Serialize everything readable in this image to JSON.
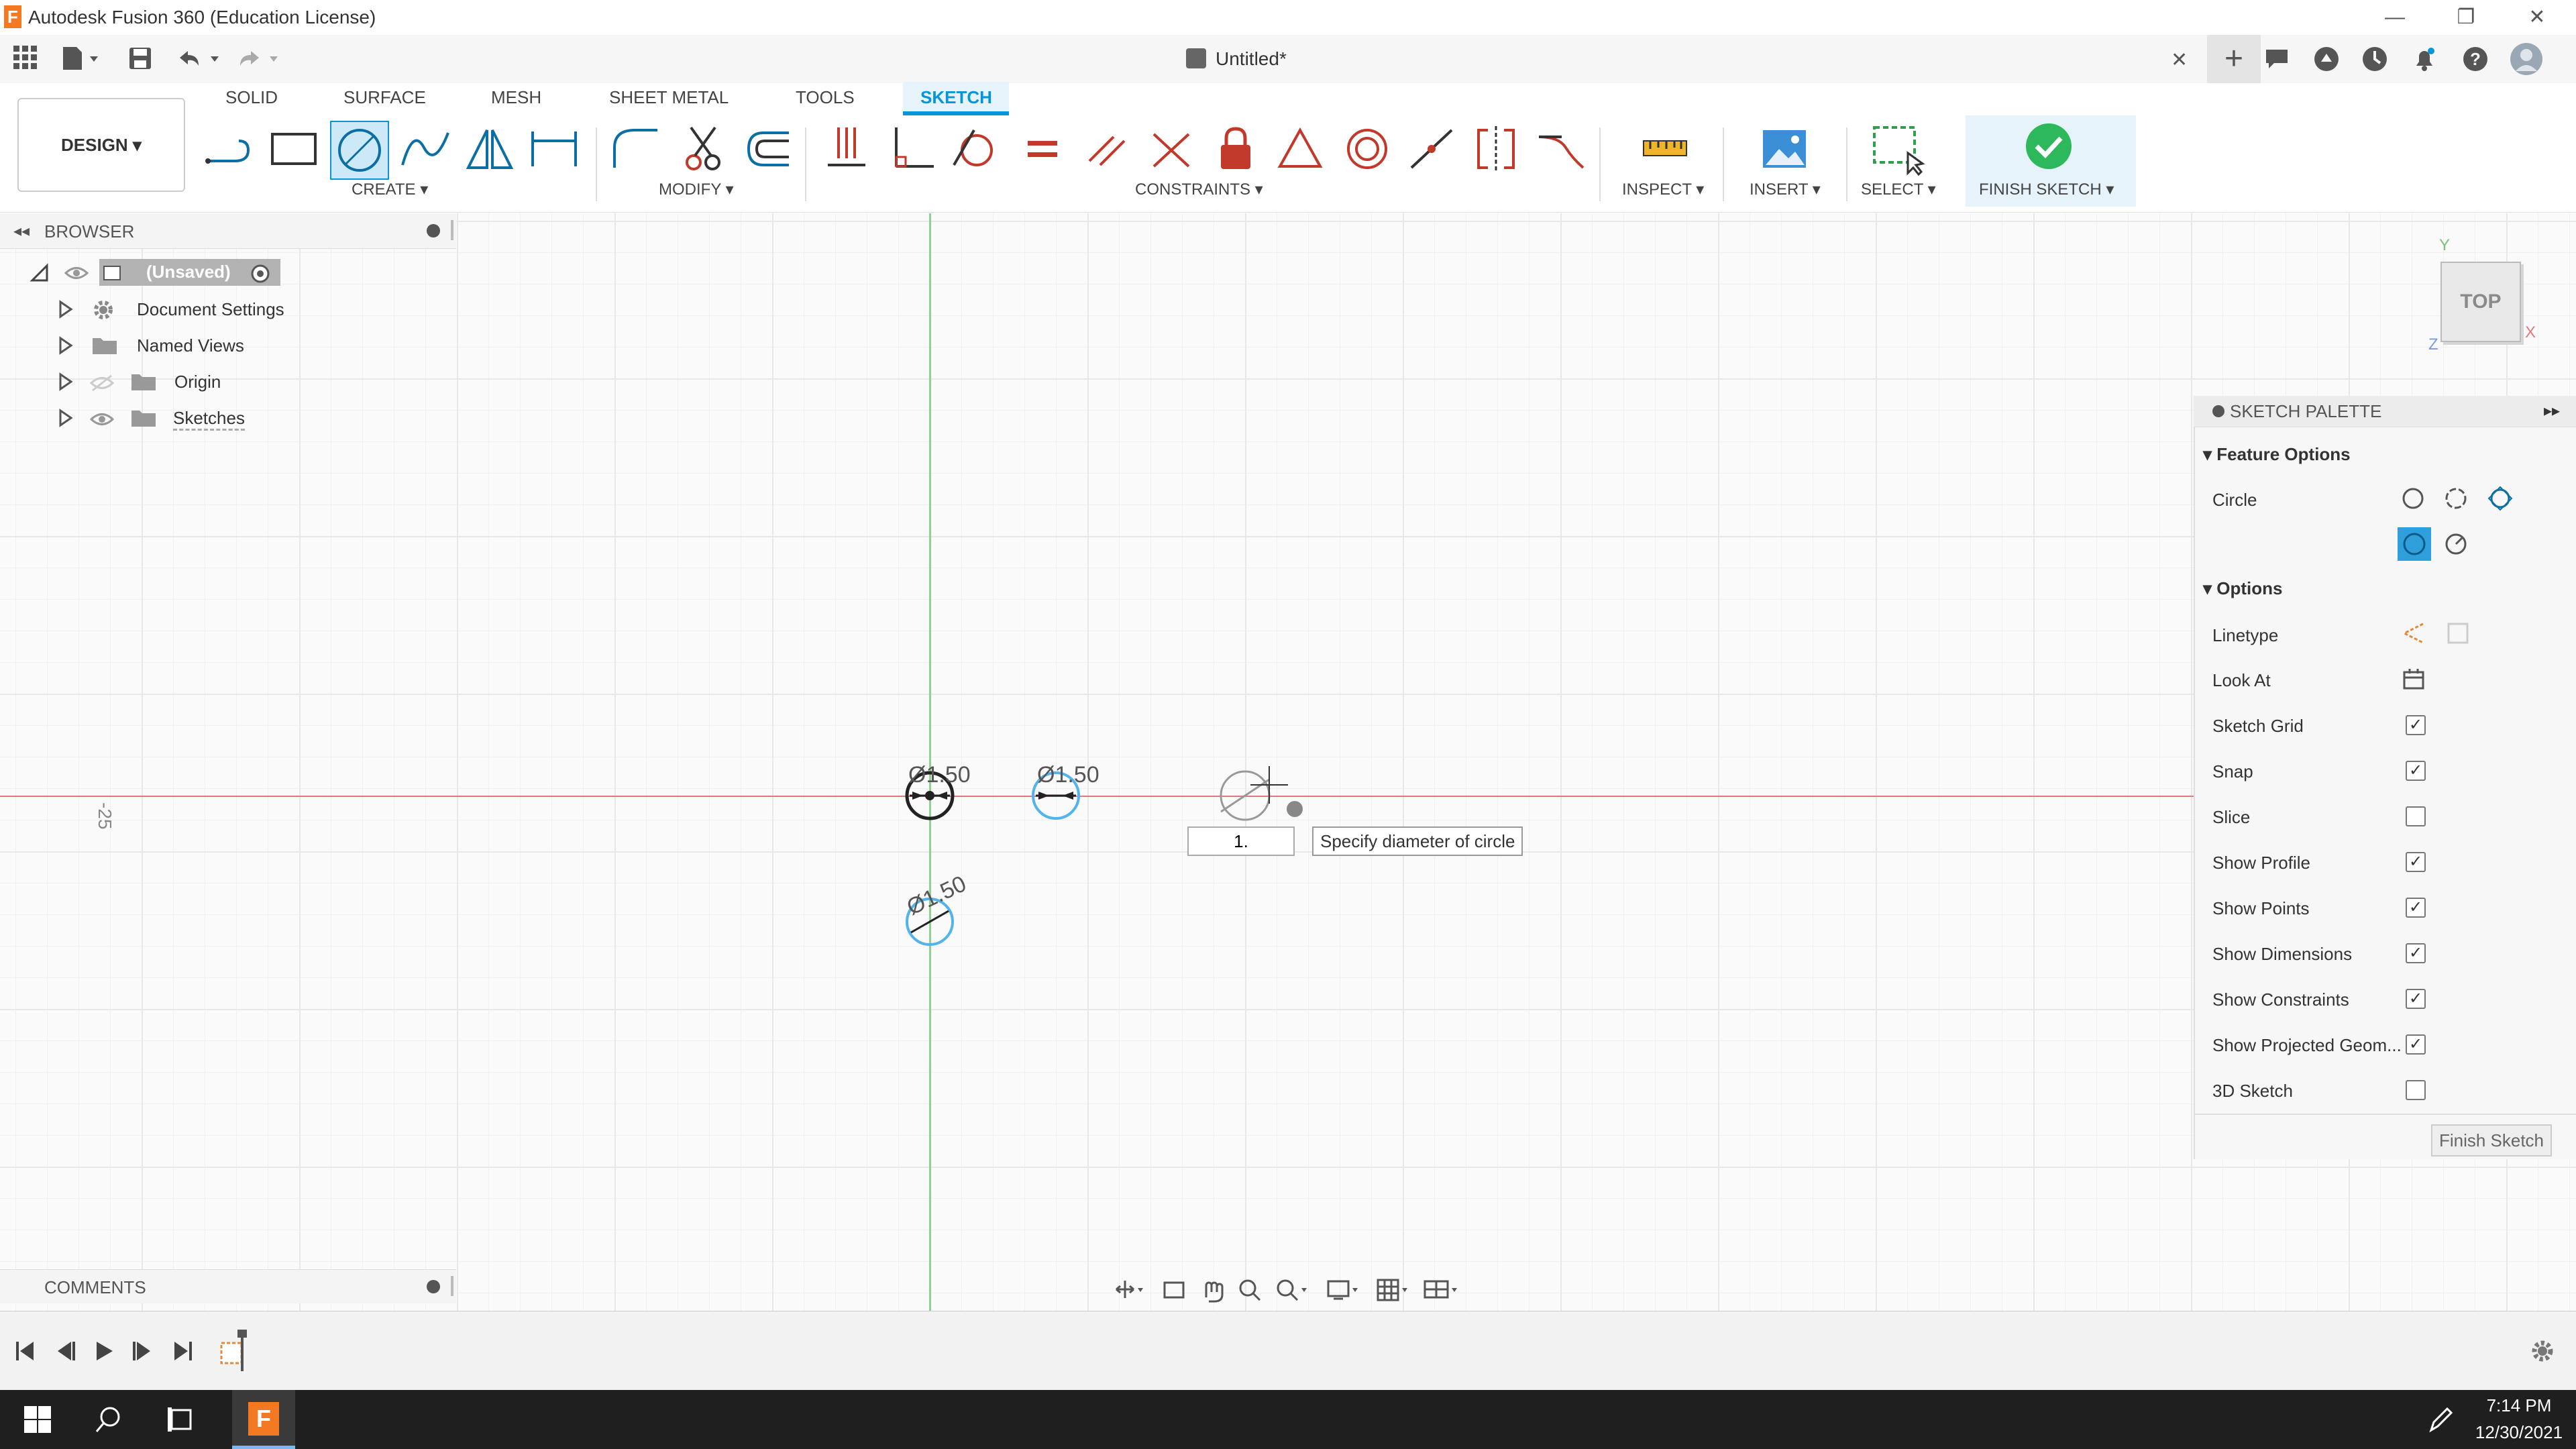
{
  "window": {
    "app_title": "Autodesk Fusion 360 (Education License)",
    "logo_letter": "F",
    "minimize": "—",
    "restore": "❐",
    "close": "✕"
  },
  "quickbar": {
    "doc_title": "Untitled*",
    "close_tab": "✕",
    "new_tab": "+"
  },
  "ribbon": {
    "tabs": [
      "SOLID",
      "SURFACE",
      "MESH",
      "SHEET METAL",
      "TOOLS",
      "SKETCH"
    ],
    "active_tab": "SKETCH",
    "design_label": "DESIGN ▾",
    "groups": {
      "create": "CREATE ▾",
      "modify": "MODIFY ▾",
      "constraints": "CONSTRAINTS ▾",
      "inspect": "INSPECT ▾",
      "insert": "INSERT ▾",
      "select": "SELECT ▾",
      "finish": "FINISH SKETCH ▾"
    },
    "accent": "#0696d7"
  },
  "browser": {
    "header": "BROWSER",
    "root": "(Unsaved)",
    "items": [
      {
        "label": "Document Settings"
      },
      {
        "label": "Named Views"
      },
      {
        "label": "Origin"
      },
      {
        "label": "Sketches"
      }
    ]
  },
  "canvas": {
    "axis_label": "-25",
    "dims": [
      "Ø1.50",
      "Ø1.50",
      "Ø1.50"
    ],
    "input_value": "1.",
    "tooltip": "Specify diameter of circle",
    "viewcube": {
      "face": "TOP",
      "x": "X",
      "y": "Y",
      "z": "Z"
    }
  },
  "palette": {
    "title": "SKETCH PALETTE",
    "feature_options": "Feature Options",
    "circle_label": "Circle",
    "options_header": "Options",
    "rows": [
      {
        "label": "Linetype",
        "type": "icon"
      },
      {
        "label": "Look At",
        "type": "icon"
      },
      {
        "label": "Sketch Grid",
        "checked": true
      },
      {
        "label": "Snap",
        "checked": true
      },
      {
        "label": "Slice",
        "checked": false
      },
      {
        "label": "Show Profile",
        "checked": true
      },
      {
        "label": "Show Points",
        "checked": true
      },
      {
        "label": "Show Dimensions",
        "checked": true
      },
      {
        "label": "Show Constraints",
        "checked": true
      },
      {
        "label": "Show Projected Geom...",
        "checked": true
      },
      {
        "label": "3D Sketch",
        "checked": false
      }
    ],
    "finish_button": "Finish Sketch"
  },
  "comments": {
    "label": "COMMENTS"
  },
  "taskbar": {
    "time": "7:14 PM",
    "date": "12/30/2021"
  }
}
